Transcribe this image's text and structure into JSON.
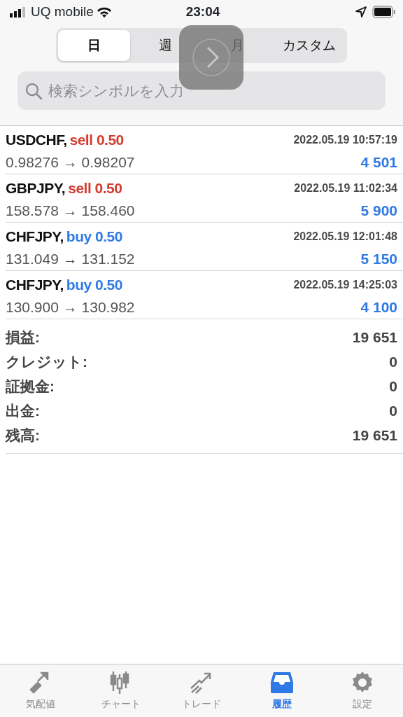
{
  "status_bar": {
    "carrier": "UQ mobile",
    "time": "23:04"
  },
  "segments": [
    {
      "label": "日",
      "selected": true
    },
    {
      "label": "週",
      "selected": false
    },
    {
      "label": "月",
      "selected": false
    },
    {
      "label": "カスタム",
      "selected": false
    }
  ],
  "search": {
    "placeholder": "検索シンボルを入力"
  },
  "trades": [
    {
      "symbol": "USDCHF,",
      "kind": "sell",
      "side": "sell 0.50",
      "time": "2022.05.19 10:57:19",
      "prices": "0.98276 → 0.98207",
      "profit": "4 501"
    },
    {
      "symbol": "GBPJPY,",
      "kind": "sell",
      "side": "sell 0.50",
      "time": "2022.05.19 11:02:34",
      "prices": "158.578 → 158.460",
      "profit": "5 900"
    },
    {
      "symbol": "CHFJPY,",
      "kind": "buy",
      "side": "buy 0.50",
      "time": "2022.05.19 12:01:48",
      "prices": "131.049 → 131.152",
      "profit": "5 150"
    },
    {
      "symbol": "CHFJPY,",
      "kind": "buy",
      "side": "buy 0.50",
      "time": "2022.05.19 14:25:03",
      "prices": "130.900 → 130.982",
      "profit": "4 100"
    }
  ],
  "summary": [
    {
      "label": "損益:",
      "value": "19 651"
    },
    {
      "label": "クレジット:",
      "value": "0"
    },
    {
      "label": "証拠金:",
      "value": "0"
    },
    {
      "label": "出金:",
      "value": "0"
    },
    {
      "label": "残高:",
      "value": "19 651"
    }
  ],
  "tab_bar": [
    {
      "label": "気配値",
      "kind": "quotes",
      "selected": false
    },
    {
      "label": "チャート",
      "kind": "chart",
      "selected": false
    },
    {
      "label": "トレード",
      "kind": "trade",
      "selected": false
    },
    {
      "label": "履歴",
      "kind": "history",
      "selected": true
    },
    {
      "label": "設定",
      "kind": "settings",
      "selected": false
    }
  ]
}
